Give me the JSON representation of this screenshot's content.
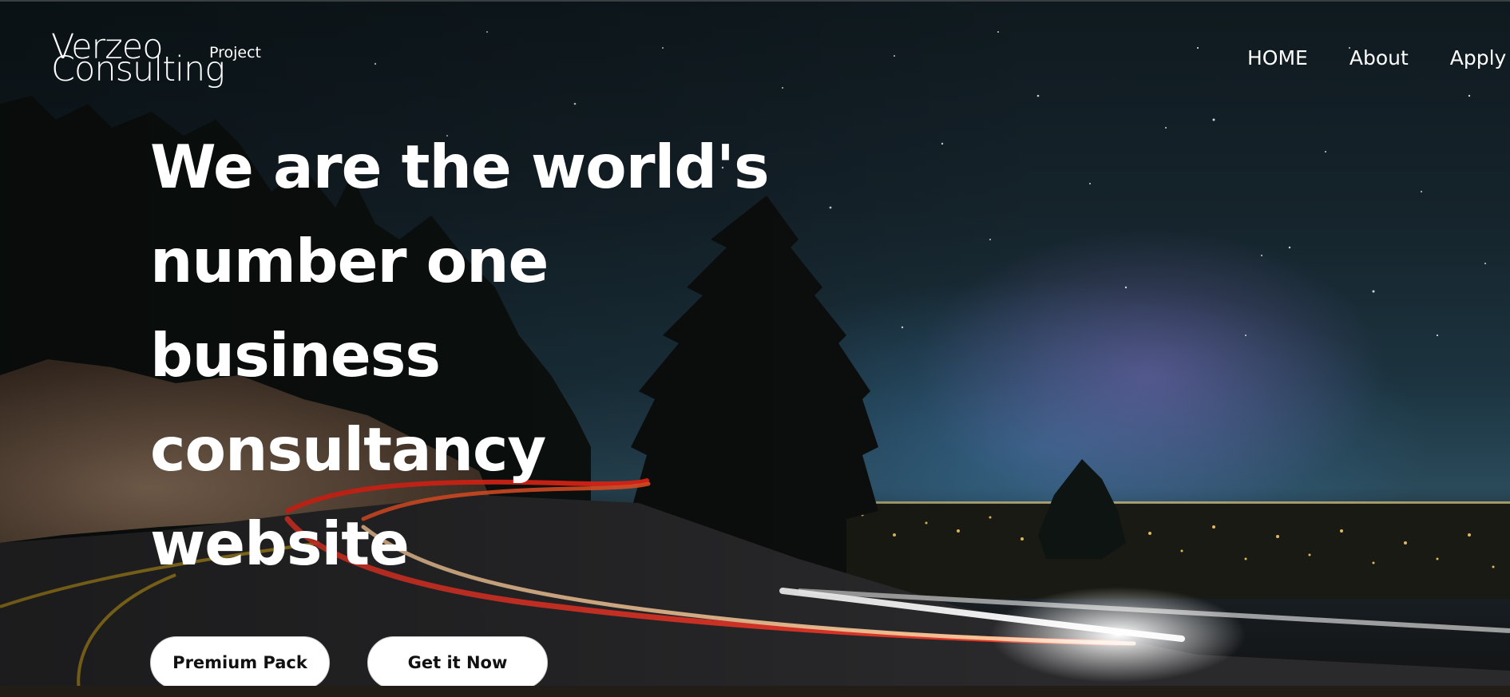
{
  "brand": {
    "name_line1": "Verzeo",
    "name_line2": "Consulting",
    "tag": "Project"
  },
  "nav": {
    "items": [
      "HOME",
      "About",
      "Apply"
    ]
  },
  "hero": {
    "headline_lines": [
      "We are the world's",
      "number one",
      "business",
      "consultancy",
      "website"
    ],
    "buttons": {
      "premium_label": "Premium Pack",
      "get_label": "Get it Now"
    }
  },
  "colors": {
    "text": "#ffffff",
    "button_bg": "#ffffff",
    "button_text": "#111111",
    "sky": "#1c3440",
    "light_trail": "#ff3a2a"
  }
}
